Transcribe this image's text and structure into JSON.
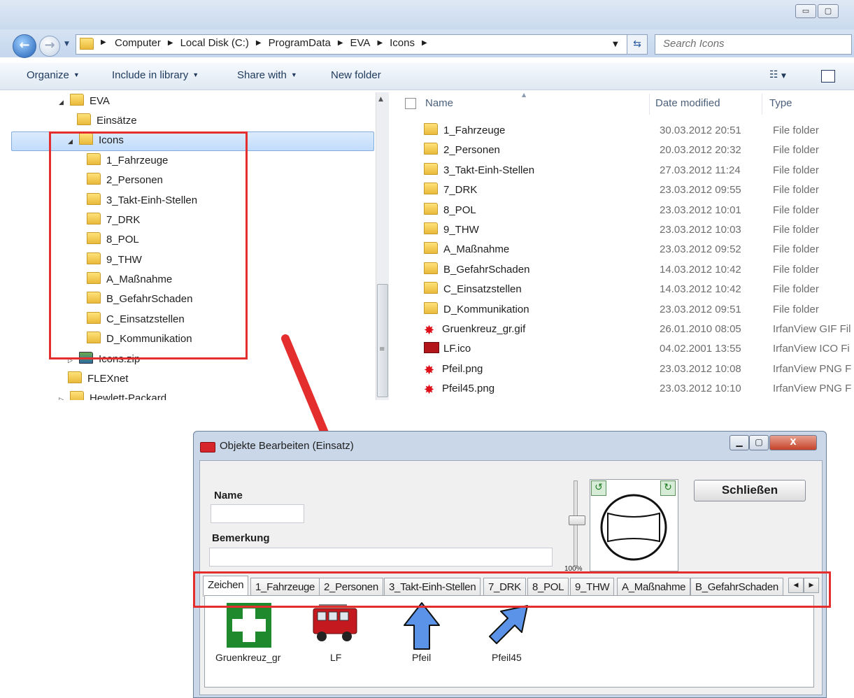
{
  "explorer": {
    "window_controls": {
      "minimize": "▭",
      "maximize": "▢"
    },
    "address": [
      "Computer",
      "Local Disk (C:)",
      "ProgramData",
      "EVA",
      "Icons"
    ],
    "search_placeholder": "Search Icons",
    "toolbar": {
      "organize": "Organize",
      "include": "Include in library",
      "share": "Share with",
      "new_folder": "New folder"
    },
    "tree": {
      "eva": "EVA",
      "einsaetze": "Einsätze",
      "icons": "Icons",
      "children": [
        "1_Fahrzeuge",
        "2_Personen",
        "3_Takt-Einh-Stellen",
        "7_DRK",
        "8_POL",
        "9_THW",
        "A_Maßnahme",
        "B_GefahrSchaden",
        "C_Einsatzstellen",
        "D_Kommunikation"
      ],
      "icons_zip": "Icons.zip",
      "flexnet": "FLEXnet",
      "hewlett": "Hewlett-Packard"
    },
    "list": {
      "headers": {
        "name": "Name",
        "date": "Date modified",
        "type": "Type"
      },
      "rows": [
        {
          "name": "1_Fahrzeuge",
          "date": "30.03.2012 20:51",
          "type": "File folder",
          "icon": "folder"
        },
        {
          "name": "2_Personen",
          "date": "20.03.2012 20:32",
          "type": "File folder",
          "icon": "folder"
        },
        {
          "name": "3_Takt-Einh-Stellen",
          "date": "27.03.2012 11:24",
          "type": "File folder",
          "icon": "folder"
        },
        {
          "name": "7_DRK",
          "date": "23.03.2012 09:55",
          "type": "File folder",
          "icon": "folder"
        },
        {
          "name": "8_POL",
          "date": "23.03.2012 10:01",
          "type": "File folder",
          "icon": "folder"
        },
        {
          "name": "9_THW",
          "date": "23.03.2012 10:03",
          "type": "File folder",
          "icon": "folder"
        },
        {
          "name": "A_Maßnahme",
          "date": "23.03.2012 09:52",
          "type": "File folder",
          "icon": "folder"
        },
        {
          "name": "B_GefahrSchaden",
          "date": "14.03.2012 10:42",
          "type": "File folder",
          "icon": "folder"
        },
        {
          "name": "C_Einsatzstellen",
          "date": "14.03.2012 10:42",
          "type": "File folder",
          "icon": "folder"
        },
        {
          "name": "D_Kommunikation",
          "date": "23.03.2012 09:51",
          "type": "File folder",
          "icon": "folder"
        },
        {
          "name": "Gruenkreuz_gr.gif",
          "date": "26.01.2010 08:05",
          "type": "IrfanView GIF Fil",
          "icon": "irfan"
        },
        {
          "name": "LF.ico",
          "date": "04.02.2001 13:55",
          "type": "IrfanView ICO Fi",
          "icon": "truck"
        },
        {
          "name": "Pfeil.png",
          "date": "23.03.2012 10:08",
          "type": "IrfanView PNG F",
          "icon": "irfan"
        },
        {
          "name": "Pfeil45.png",
          "date": "23.03.2012 10:10",
          "type": "IrfanView PNG F",
          "icon": "irfan"
        }
      ]
    }
  },
  "dialog": {
    "title": "Objekte Bearbeiten (Einsatz)",
    "name_label": "Name",
    "bemerkung_label": "Bemerkung",
    "zoom_label": "100%",
    "close_button": "Schließen",
    "tabs": [
      "Zeichen",
      "1_Fahrzeuge",
      "2_Personen",
      "3_Takt-Einh-Stellen",
      "7_DRK",
      "8_POL",
      "9_THW",
      "A_Maßnahme",
      "B_GefahrSchaden"
    ],
    "icons": [
      "Gruenkreuz_gr",
      "LF",
      "Pfeil",
      "Pfeil45"
    ]
  },
  "colors": {
    "highlight_red": "#e42d2d",
    "arrow_blue": "#5a93e8",
    "cross_green": "#1f8a2d"
  }
}
